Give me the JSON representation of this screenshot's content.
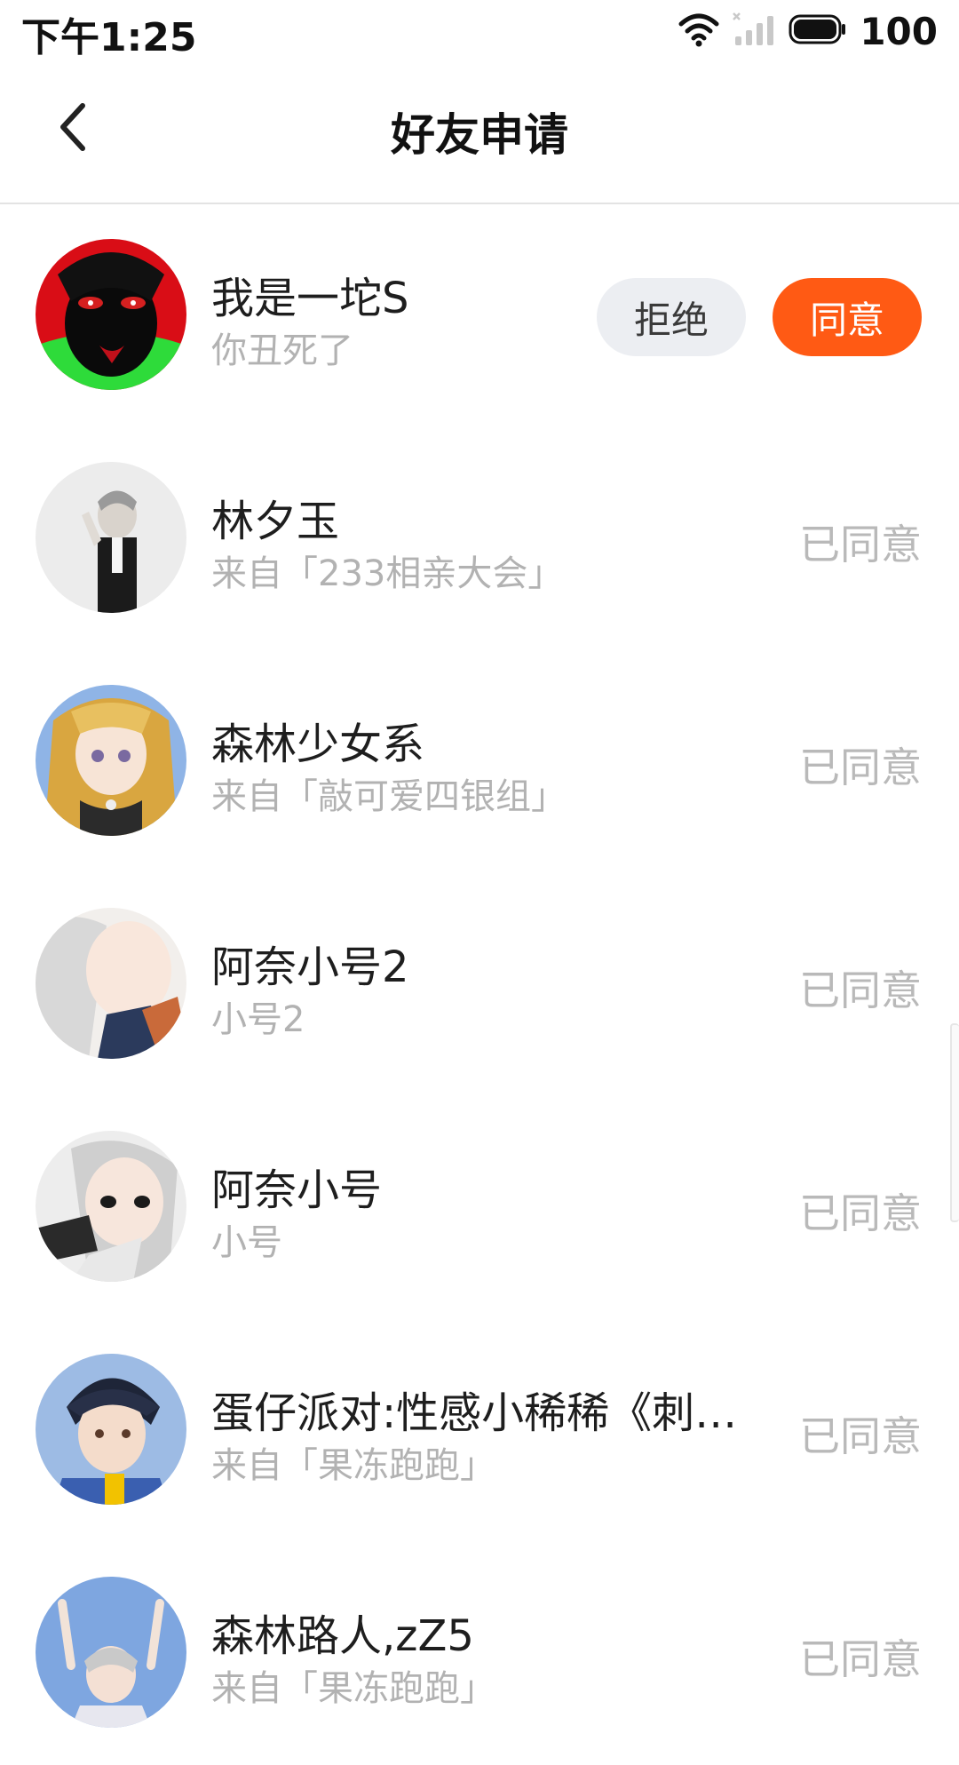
{
  "status_bar": {
    "time": "下午1:25",
    "battery": "100",
    "icons": [
      "wifi-icon",
      "signal-off-icon",
      "battery-icon"
    ]
  },
  "header": {
    "title": "好友申请",
    "back_icon": "back-arrow-icon"
  },
  "colors": {
    "accent": "#ff5a14",
    "reject_bg": "#eceef2",
    "muted_text": "#b2b2b2"
  },
  "requests": [
    {
      "name": "我是一坨S",
      "subtitle": "你丑死了",
      "reject_label": "拒绝",
      "accept_label": "同意"
    },
    {
      "name": "林夕玉",
      "subtitle": "来自「233相亲大会」",
      "status": "已同意"
    },
    {
      "name": "森林少女系",
      "subtitle": "来自「敲可爱四银组」",
      "status": "已同意"
    },
    {
      "name": "阿奈小号2",
      "subtitle": "小号2",
      "status": "已同意"
    },
    {
      "name": "阿奈小号",
      "subtitle": "小号",
      "status": "已同意"
    },
    {
      "name": "蛋仔派对:性感小稀稀《刺…",
      "subtitle": "来自「果冻跑跑」",
      "status": "已同意"
    },
    {
      "name": "森林路人,zZ5",
      "subtitle": "来自「果冻跑跑」",
      "status": "已同意"
    }
  ]
}
